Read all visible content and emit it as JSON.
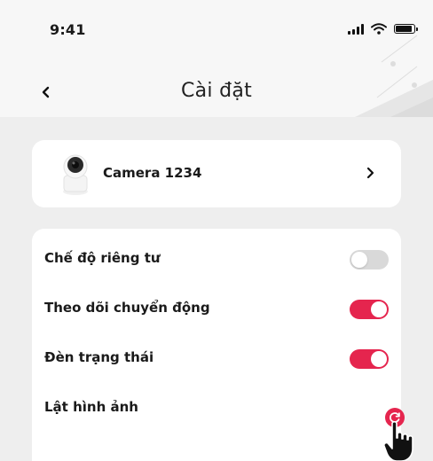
{
  "status_bar": {
    "time": "9:41"
  },
  "nav": {
    "title": "Cài đặt"
  },
  "device": {
    "name": "Camera 1234"
  },
  "settings": [
    {
      "label": "Chế độ riêng tư",
      "state": "off"
    },
    {
      "label": "Theo dõi chuyển động",
      "state": "on"
    },
    {
      "label": "Đèn trạng thái",
      "state": "on"
    },
    {
      "label": "Lật hình ảnh",
      "state": "action"
    }
  ],
  "colors": {
    "accent": "#e5254e",
    "toggle_off": "#d9d9d9",
    "background": "#eeeeee",
    "card": "#ffffff"
  },
  "icons": [
    "back-chevron-icon",
    "camera-device-icon",
    "forward-chevron-icon",
    "rotate-icon",
    "hand-cursor-icon",
    "signal-icon",
    "wifi-icon",
    "battery-icon"
  ]
}
